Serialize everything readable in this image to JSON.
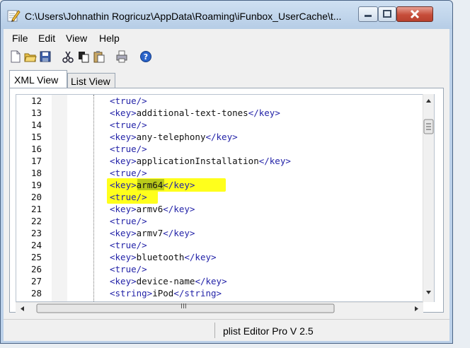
{
  "window": {
    "title": "C:\\Users\\Johnathin Rogricuz\\AppData\\Roaming\\iFunbox_UserCache\\t..."
  },
  "menubar": {
    "items": [
      {
        "label": "File"
      },
      {
        "label": "Edit"
      },
      {
        "label": "View"
      },
      {
        "label": "Help"
      }
    ]
  },
  "toolbar": {
    "icons": [
      "new-file-icon",
      "open-folder-icon",
      "save-icon",
      "cut-icon",
      "copy-icon",
      "paste-icon",
      "print-icon",
      "help-icon"
    ]
  },
  "tabs": [
    {
      "label": "XML View",
      "selected": true
    },
    {
      "label": "List View",
      "selected": false
    }
  ],
  "editor": {
    "lines": [
      {
        "num": "12",
        "text": "<true/>"
      },
      {
        "num": "13",
        "text": "<key>additional-text-tones</key>"
      },
      {
        "num": "14",
        "text": "<true/>"
      },
      {
        "num": "15",
        "text": "<key>any-telephony</key>"
      },
      {
        "num": "16",
        "text": "<true/>"
      },
      {
        "num": "17",
        "text": "<key>applicationInstallation</key>"
      },
      {
        "num": "18",
        "text": "<true/>"
      },
      {
        "num": "19",
        "text": "<key>arm64</key>",
        "highlight": true
      },
      {
        "num": "20",
        "text": "<true/>",
        "highlight": true
      },
      {
        "num": "21",
        "text": "<key>armv6</key>"
      },
      {
        "num": "22",
        "text": "<true/>"
      },
      {
        "num": "23",
        "text": "<key>armv7</key>"
      },
      {
        "num": "24",
        "text": "<true/>"
      },
      {
        "num": "25",
        "text": "<key>bluetooth</key>"
      },
      {
        "num": "26",
        "text": "<true/>"
      },
      {
        "num": "27",
        "text": "<key>device-name</key>"
      },
      {
        "num": "28",
        "text": "<string>iPod</string>"
      }
    ],
    "highlight_color": "#ffff1c",
    "selection_color": "#b9c91a",
    "tag_color": "#2323a8",
    "text_color": "#111111"
  },
  "scrollbar": {
    "hscroll_grip": "III"
  },
  "status": {
    "text": "plist Editor Pro V 2.5"
  }
}
